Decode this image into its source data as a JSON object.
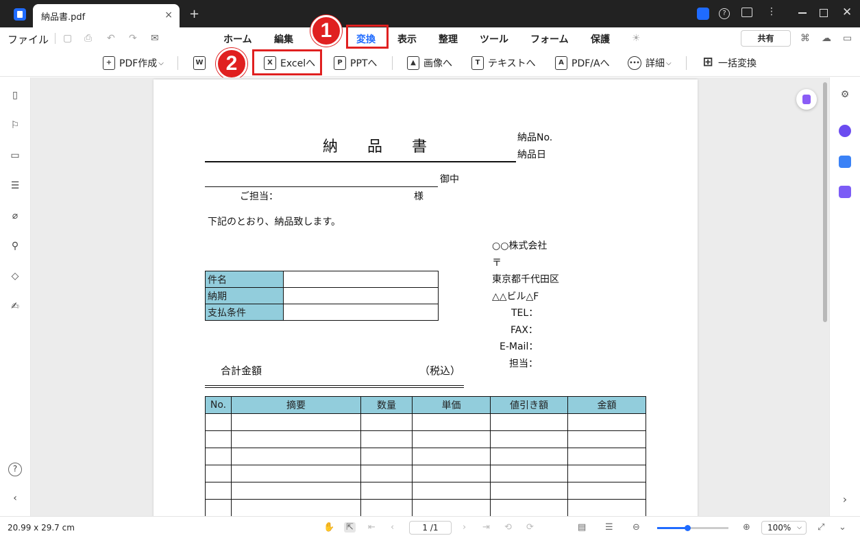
{
  "window": {
    "tab_title": "納品書.pdf",
    "tab_close": "×",
    "new_tab": "+"
  },
  "menubar": {
    "file": "ファイル",
    "items": [
      "ホーム",
      "編集",
      "変換",
      "表示",
      "整理",
      "ツール",
      "フォーム",
      "保護"
    ],
    "active": "変換",
    "share": "共有"
  },
  "toolbar": {
    "items": [
      {
        "label": "PDF作成",
        "icon": "pdf-create-icon",
        "glyph": "+"
      },
      {
        "label": "W",
        "icon": "word-icon",
        "glyph": "W"
      },
      {
        "label": "Excelへ",
        "icon": "excel-icon",
        "glyph": "X"
      },
      {
        "label": "PPTへ",
        "icon": "ppt-icon",
        "glyph": "P"
      },
      {
        "label": "画像へ",
        "icon": "image-icon",
        "glyph": "▲"
      },
      {
        "label": "テキストへ",
        "icon": "text-icon",
        "glyph": "T"
      },
      {
        "label": "PDF/Aへ",
        "icon": "pdfa-icon",
        "glyph": "A"
      },
      {
        "label": "詳細",
        "icon": "more-icon",
        "glyph": "•••"
      },
      {
        "label": "一括変換",
        "icon": "batch-convert-icon",
        "glyph": "⊞"
      }
    ],
    "dropdown_caret": "⌵"
  },
  "annotations": {
    "step1": "1",
    "step2": "2",
    "highlight_color": "#e02020"
  },
  "document": {
    "title": "納 品 書",
    "no_label": "納品No.",
    "date_label": "納品日",
    "onchu": "御中",
    "tanto": "ご担当：",
    "sama": "様",
    "intro": "下記のとおり、納品致します。",
    "company": "○○株式会社",
    "postal": "〒",
    "address1": "東京都千代田区",
    "address2": "△△ビル△F",
    "tel": "TEL：",
    "fax": "FAX：",
    "email": "E-Mail：",
    "person": "担当：",
    "info_rows": [
      "件名",
      "納期",
      "支払条件"
    ],
    "total_label": "合計金額",
    "tax_label": "（税込）",
    "table_headers": [
      "No.",
      "摘要",
      "数量",
      "単価",
      "値引き額",
      "金額"
    ]
  },
  "statusbar": {
    "page_size": "20.99 x 29.7 cm",
    "page_indicator": "1 /1",
    "zoom": "100%",
    "zoom_level": 0.42
  },
  "colors": {
    "accent": "#1f6bff",
    "table_header_fill": "#92cddc",
    "titlebar": "#222222"
  }
}
